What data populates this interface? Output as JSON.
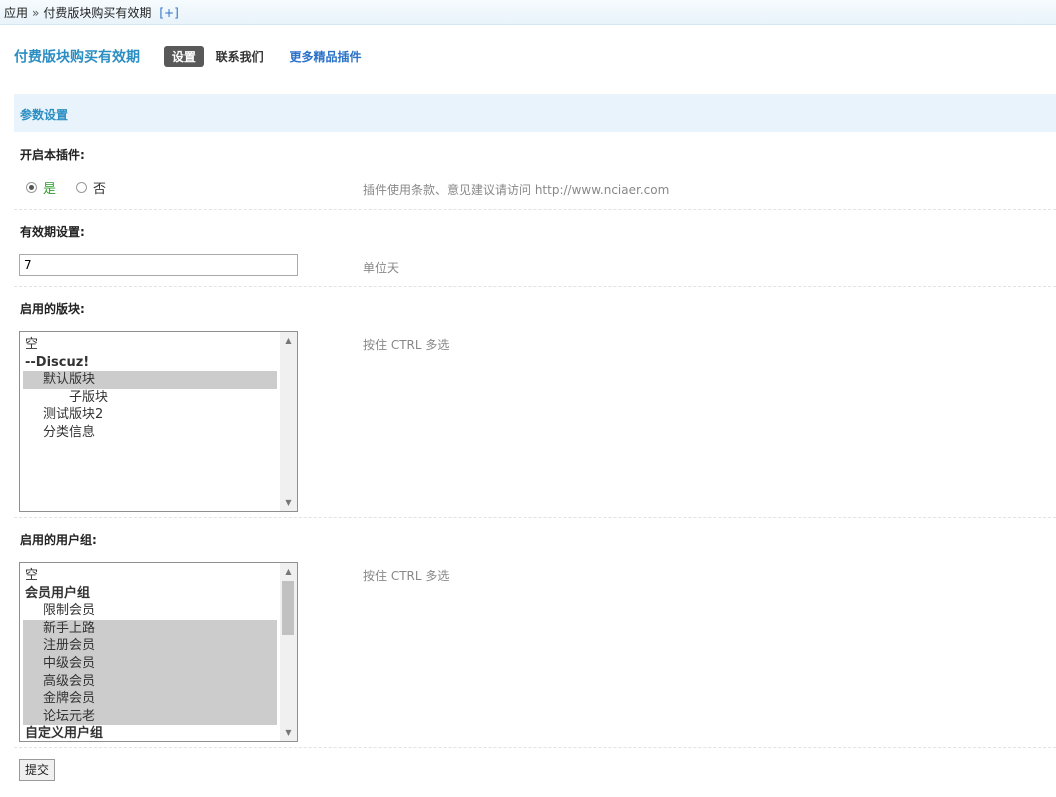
{
  "breadcrumb": {
    "root": "应用",
    "separator": "»",
    "current": "付费版块购买有效期",
    "add": "[+]"
  },
  "header": {
    "title": "付费版块购买有效期",
    "tabs": [
      {
        "label": "设置",
        "active": true
      },
      {
        "label": "联系我们"
      },
      {
        "label": "更多精品插件"
      }
    ]
  },
  "section_title": "参数设置",
  "fields": {
    "enable": {
      "label": "开启本插件:",
      "yes": "是",
      "no": "否",
      "selected": "是",
      "hint": "插件使用条款、意见建议请访问 http://www.nciaer.com"
    },
    "validity": {
      "label": "有效期设置:",
      "value": "7",
      "hint": "单位天"
    },
    "forums": {
      "label": "启用的版块:",
      "hint": "按住 CTRL 多选",
      "options": [
        {
          "text": "空",
          "selected": false
        },
        {
          "text": "--Discuz!",
          "selected": false
        },
        {
          "text": "默认版块",
          "selected": true
        },
        {
          "text": "子版块",
          "selected": false
        },
        {
          "text": "测试版块2",
          "selected": false
        },
        {
          "text": "分类信息",
          "selected": false
        }
      ]
    },
    "usergroups": {
      "label": "启用的用户组:",
      "hint": "按住 CTRL 多选",
      "options": [
        {
          "text": "空",
          "selected": false
        },
        {
          "text": "会员用户组",
          "selected": false
        },
        {
          "text": "限制会员",
          "selected": false
        },
        {
          "text": "新手上路",
          "selected": true
        },
        {
          "text": "注册会员",
          "selected": true
        },
        {
          "text": "中级会员",
          "selected": true
        },
        {
          "text": "高级会员",
          "selected": true
        },
        {
          "text": "金牌会员",
          "selected": true
        },
        {
          "text": "论坛元老",
          "selected": true
        },
        {
          "text": "自定义用户组",
          "selected": false
        }
      ]
    }
  },
  "submit_label": "提交",
  "colors": {
    "accent": "#2b8ec2",
    "link": "#2b72c8",
    "section_bg": "#e8f3fb",
    "radio_yes": "#2e9e2e",
    "selected_option_bg": "#cccccc"
  }
}
